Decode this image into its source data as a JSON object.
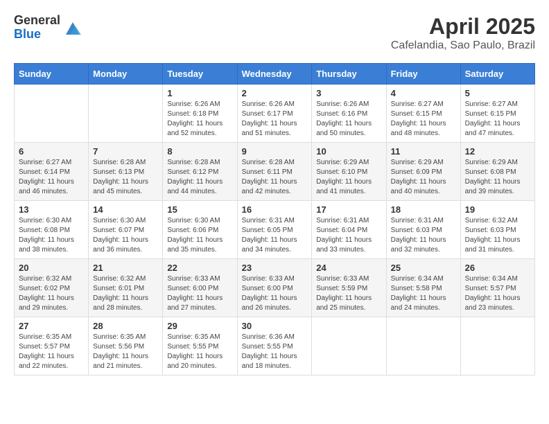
{
  "header": {
    "logo_general": "General",
    "logo_blue": "Blue",
    "month_year": "April 2025",
    "location": "Cafelandia, Sao Paulo, Brazil"
  },
  "days_of_week": [
    "Sunday",
    "Monday",
    "Tuesday",
    "Wednesday",
    "Thursday",
    "Friday",
    "Saturday"
  ],
  "weeks": [
    [
      {
        "day": "",
        "info": ""
      },
      {
        "day": "",
        "info": ""
      },
      {
        "day": "1",
        "info": "Sunrise: 6:26 AM\nSunset: 6:18 PM\nDaylight: 11 hours and 52 minutes."
      },
      {
        "day": "2",
        "info": "Sunrise: 6:26 AM\nSunset: 6:17 PM\nDaylight: 11 hours and 51 minutes."
      },
      {
        "day": "3",
        "info": "Sunrise: 6:26 AM\nSunset: 6:16 PM\nDaylight: 11 hours and 50 minutes."
      },
      {
        "day": "4",
        "info": "Sunrise: 6:27 AM\nSunset: 6:15 PM\nDaylight: 11 hours and 48 minutes."
      },
      {
        "day": "5",
        "info": "Sunrise: 6:27 AM\nSunset: 6:15 PM\nDaylight: 11 hours and 47 minutes."
      }
    ],
    [
      {
        "day": "6",
        "info": "Sunrise: 6:27 AM\nSunset: 6:14 PM\nDaylight: 11 hours and 46 minutes."
      },
      {
        "day": "7",
        "info": "Sunrise: 6:28 AM\nSunset: 6:13 PM\nDaylight: 11 hours and 45 minutes."
      },
      {
        "day": "8",
        "info": "Sunrise: 6:28 AM\nSunset: 6:12 PM\nDaylight: 11 hours and 44 minutes."
      },
      {
        "day": "9",
        "info": "Sunrise: 6:28 AM\nSunset: 6:11 PM\nDaylight: 11 hours and 42 minutes."
      },
      {
        "day": "10",
        "info": "Sunrise: 6:29 AM\nSunset: 6:10 PM\nDaylight: 11 hours and 41 minutes."
      },
      {
        "day": "11",
        "info": "Sunrise: 6:29 AM\nSunset: 6:09 PM\nDaylight: 11 hours and 40 minutes."
      },
      {
        "day": "12",
        "info": "Sunrise: 6:29 AM\nSunset: 6:08 PM\nDaylight: 11 hours and 39 minutes."
      }
    ],
    [
      {
        "day": "13",
        "info": "Sunrise: 6:30 AM\nSunset: 6:08 PM\nDaylight: 11 hours and 38 minutes."
      },
      {
        "day": "14",
        "info": "Sunrise: 6:30 AM\nSunset: 6:07 PM\nDaylight: 11 hours and 36 minutes."
      },
      {
        "day": "15",
        "info": "Sunrise: 6:30 AM\nSunset: 6:06 PM\nDaylight: 11 hours and 35 minutes."
      },
      {
        "day": "16",
        "info": "Sunrise: 6:31 AM\nSunset: 6:05 PM\nDaylight: 11 hours and 34 minutes."
      },
      {
        "day": "17",
        "info": "Sunrise: 6:31 AM\nSunset: 6:04 PM\nDaylight: 11 hours and 33 minutes."
      },
      {
        "day": "18",
        "info": "Sunrise: 6:31 AM\nSunset: 6:03 PM\nDaylight: 11 hours and 32 minutes."
      },
      {
        "day": "19",
        "info": "Sunrise: 6:32 AM\nSunset: 6:03 PM\nDaylight: 11 hours and 31 minutes."
      }
    ],
    [
      {
        "day": "20",
        "info": "Sunrise: 6:32 AM\nSunset: 6:02 PM\nDaylight: 11 hours and 29 minutes."
      },
      {
        "day": "21",
        "info": "Sunrise: 6:32 AM\nSunset: 6:01 PM\nDaylight: 11 hours and 28 minutes."
      },
      {
        "day": "22",
        "info": "Sunrise: 6:33 AM\nSunset: 6:00 PM\nDaylight: 11 hours and 27 minutes."
      },
      {
        "day": "23",
        "info": "Sunrise: 6:33 AM\nSunset: 6:00 PM\nDaylight: 11 hours and 26 minutes."
      },
      {
        "day": "24",
        "info": "Sunrise: 6:33 AM\nSunset: 5:59 PM\nDaylight: 11 hours and 25 minutes."
      },
      {
        "day": "25",
        "info": "Sunrise: 6:34 AM\nSunset: 5:58 PM\nDaylight: 11 hours and 24 minutes."
      },
      {
        "day": "26",
        "info": "Sunrise: 6:34 AM\nSunset: 5:57 PM\nDaylight: 11 hours and 23 minutes."
      }
    ],
    [
      {
        "day": "27",
        "info": "Sunrise: 6:35 AM\nSunset: 5:57 PM\nDaylight: 11 hours and 22 minutes."
      },
      {
        "day": "28",
        "info": "Sunrise: 6:35 AM\nSunset: 5:56 PM\nDaylight: 11 hours and 21 minutes."
      },
      {
        "day": "29",
        "info": "Sunrise: 6:35 AM\nSunset: 5:55 PM\nDaylight: 11 hours and 20 minutes."
      },
      {
        "day": "30",
        "info": "Sunrise: 6:36 AM\nSunset: 5:55 PM\nDaylight: 11 hours and 18 minutes."
      },
      {
        "day": "",
        "info": ""
      },
      {
        "day": "",
        "info": ""
      },
      {
        "day": "",
        "info": ""
      }
    ]
  ]
}
